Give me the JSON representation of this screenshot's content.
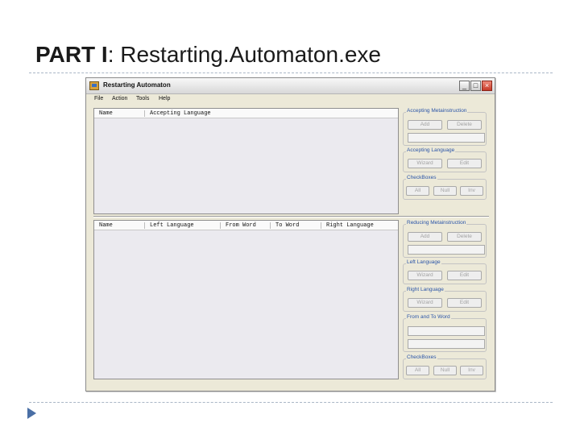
{
  "slide": {
    "title_bold": "PART I",
    "title_rest": ": Restarting.Automaton.exe"
  },
  "window": {
    "title": "Restarting Automaton",
    "controls": {
      "minimize": "_",
      "maximize": "□",
      "close": "×"
    }
  },
  "menu": [
    "File",
    "Action",
    "Tools",
    "Help"
  ],
  "upper_list": {
    "columns": [
      "Name",
      "Accepting Language"
    ]
  },
  "lower_list": {
    "columns": [
      "Name",
      "Left Language",
      "From Word",
      "To Word",
      "Right Language"
    ]
  },
  "upper_groups": {
    "accepting_metainstruction": {
      "label": "Accepting Metainstruction",
      "add": "Add",
      "delete": "Delete"
    },
    "accepting_language": {
      "label": "Accepting Language",
      "wizard": "Wizard",
      "edit": "Edit"
    },
    "checkboxes": {
      "label": "CheckBoxes",
      "all": "All",
      "null": "Null",
      "inv": "Inv"
    }
  },
  "lower_groups": {
    "reducing_metainstruction": {
      "label": "Reducing Metainstruction",
      "add": "Add",
      "delete": "Delete"
    },
    "left_language": {
      "label": "Left Language",
      "wizard": "Wizard",
      "edit": "Edit"
    },
    "right_language": {
      "label": "Right Language",
      "wizard": "Wizard",
      "edit": "Edit"
    },
    "from_to_word": {
      "label": "From and To Word"
    },
    "checkboxes": {
      "label": "CheckBoxes",
      "all": "All",
      "null": "Null",
      "inv": "Inv"
    }
  },
  "colors": {
    "accent_legend": "#2b55a8",
    "disabled_text": "#a2a2a2",
    "window_bg": "#ece9d8"
  }
}
